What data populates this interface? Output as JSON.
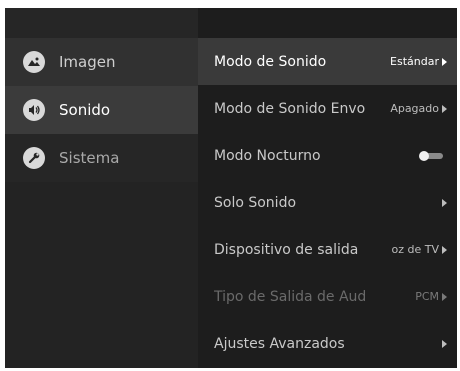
{
  "sidebar": {
    "items": [
      {
        "label": "Imagen",
        "icon": "image-icon"
      },
      {
        "label": "Sonido",
        "icon": "speaker-icon"
      },
      {
        "label": "Sistema",
        "icon": "wrench-icon"
      }
    ],
    "active_index": 1
  },
  "main": {
    "rows": [
      {
        "label": "Modo de Sonido",
        "value": "Estándar",
        "type": "select"
      },
      {
        "label": "Modo de Sonido Envo",
        "value": "Apagado",
        "type": "select"
      },
      {
        "label": "Modo Nocturno",
        "value": "",
        "type": "toggle",
        "toggle_on": false
      },
      {
        "label": "Solo Sonido",
        "value": "",
        "type": "select"
      },
      {
        "label": "Dispositivo de salida",
        "value": "oz de TV",
        "type": "select"
      },
      {
        "label": "Tipo de Salida de Aud",
        "value": "PCM",
        "type": "select",
        "disabled": true
      },
      {
        "label": "Ajustes Avanzados",
        "value": "",
        "type": "select"
      }
    ],
    "active_index": 0
  },
  "colors": {
    "background": "#1c1c1c",
    "sidebar": "#262626",
    "active_row": "#3a3a3a",
    "text": "#ffffff",
    "muted_text": "#a9a9a9"
  }
}
